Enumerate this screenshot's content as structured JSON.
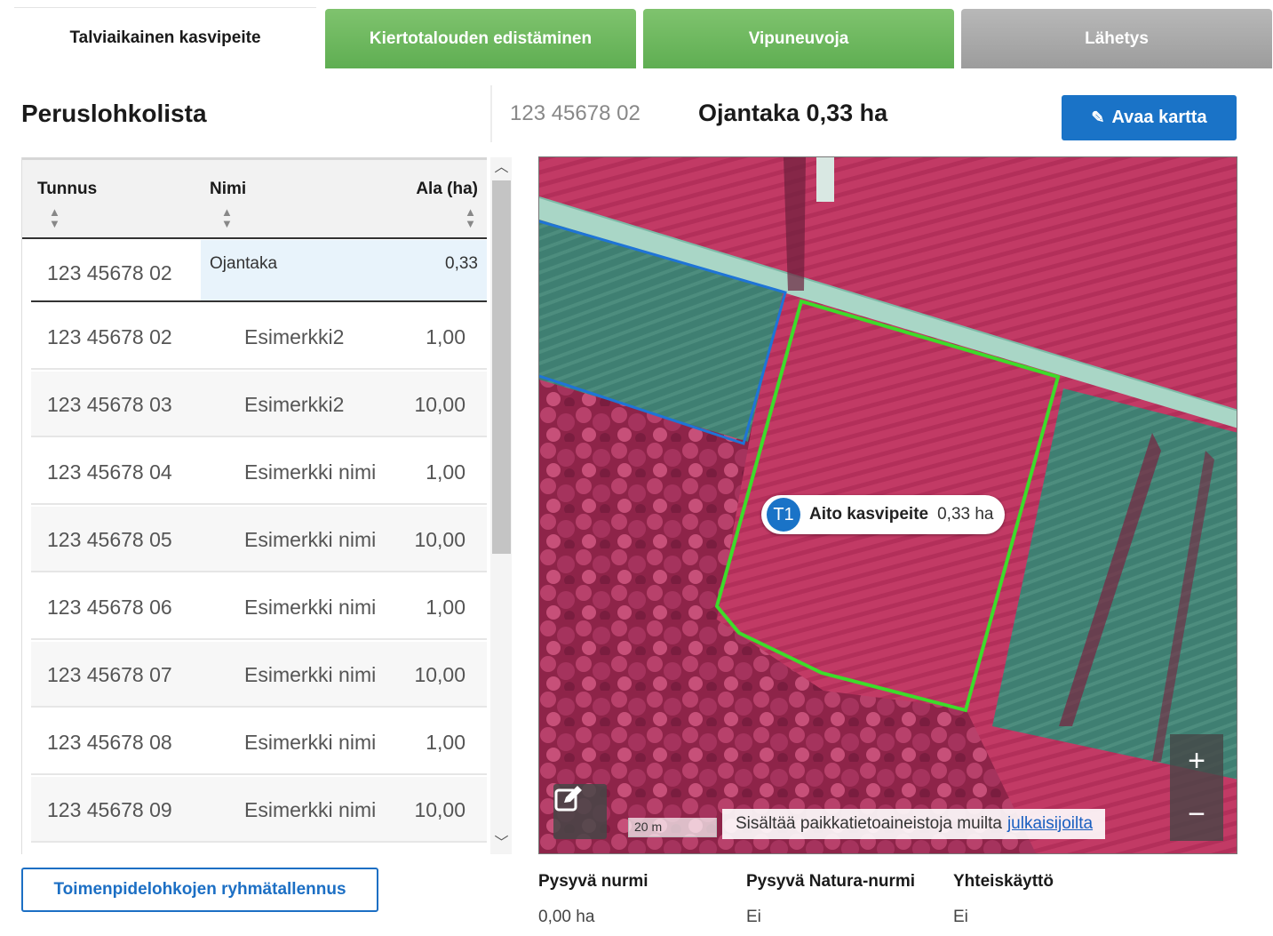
{
  "tabs": [
    {
      "label": "Talviaikainen kasvipeite"
    },
    {
      "label": "Kiertotalouden edistäminen"
    },
    {
      "label": "Vipuneuvoja"
    },
    {
      "label": "Lähetys"
    }
  ],
  "left": {
    "title": "Peruslohkolista",
    "columns": {
      "tunnus": "Tunnus",
      "nimi": "Nimi",
      "ala": "Ala (ha)"
    },
    "selected_row": {
      "tunnus": "123 45678 02",
      "nimi": "Ojantaka",
      "ala": "0,33"
    },
    "rows": [
      {
        "tunnus": "123 45678 02",
        "nimi": "Esimerkki2",
        "ala": "1,00"
      },
      {
        "tunnus": "123 45678 03",
        "nimi": "Esimerkki2",
        "ala": "10,00"
      },
      {
        "tunnus": "123 45678 04",
        "nimi": "Esimerkki nimi",
        "ala": "1,00"
      },
      {
        "tunnus": "123 45678 05",
        "nimi": "Esimerkki nimi",
        "ala": "10,00"
      },
      {
        "tunnus": "123 45678 06",
        "nimi": "Esimerkki nimi",
        "ala": "1,00"
      },
      {
        "tunnus": "123 45678 07",
        "nimi": "Esimerkki nimi",
        "ala": "10,00"
      },
      {
        "tunnus": "123 45678 08",
        "nimi": "Esimerkki nimi",
        "ala": "1,00"
      },
      {
        "tunnus": "123 45678 09",
        "nimi": "Esimerkki nimi",
        "ala": "10,00"
      }
    ],
    "group_save_label": "Toimenpidelohkojen ryhmätallennus"
  },
  "right": {
    "block_id": "123 45678 02",
    "block_title": "Ojantaka 0,33 ha",
    "open_map_label": "Avaa kartta",
    "map": {
      "field_badge": "T1",
      "field_label": "Aito kasvipeite",
      "field_area": "0,33 ha",
      "scale_label": "20 m",
      "attribution_text": "Sisältää paikkatietoaineistoja muilta",
      "attribution_link": "julkaisijoilta",
      "zoom_in": "+",
      "zoom_out": "−"
    },
    "info": [
      {
        "label": "Pysyvä nurmi",
        "value": "0,00 ha"
      },
      {
        "label": "Pysyvä Natura-nurmi",
        "value": "Ei"
      },
      {
        "label": "Yhteiskäyttö",
        "value": "Ei"
      }
    ]
  },
  "colors": {
    "accent": "#1a73c7",
    "tab_green": "#6bb85c",
    "tab_gray": "#a8a8a8",
    "field_outline": "#3ddc2a",
    "parcel_outline": "#1f74d6"
  },
  "icons": {
    "sort": "sort-icon",
    "edit": "edit-icon",
    "scroll_up": "chevron-up-icon",
    "scroll_down": "chevron-down-icon"
  }
}
